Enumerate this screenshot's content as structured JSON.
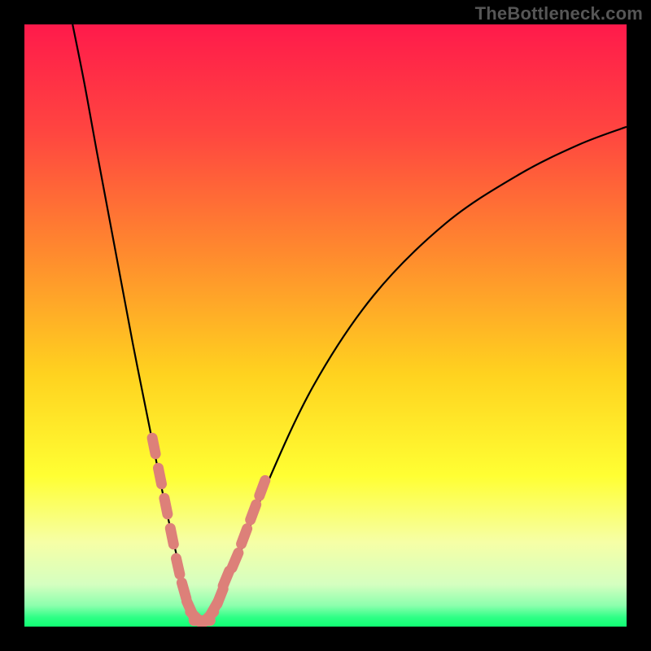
{
  "watermark": "TheBottleneck.com",
  "colors": {
    "frame": "#000000",
    "curve": "#000000",
    "dot_fill": "#dd8079",
    "gradient_stops": [
      {
        "pos": 0.0,
        "color": "#ff1a4b"
      },
      {
        "pos": 0.18,
        "color": "#ff4640"
      },
      {
        "pos": 0.38,
        "color": "#ff8a2e"
      },
      {
        "pos": 0.58,
        "color": "#ffd21f"
      },
      {
        "pos": 0.75,
        "color": "#ffff33"
      },
      {
        "pos": 0.86,
        "color": "#f6ffa6"
      },
      {
        "pos": 0.93,
        "color": "#d5ffc0"
      },
      {
        "pos": 0.965,
        "color": "#8cffad"
      },
      {
        "pos": 0.985,
        "color": "#2dff85"
      },
      {
        "pos": 1.0,
        "color": "#10ff73"
      }
    ]
  },
  "chart_data": {
    "type": "line",
    "title": "",
    "xlabel": "",
    "ylabel": "",
    "xlim": [
      0,
      100
    ],
    "ylim": [
      0,
      100
    ],
    "series": [
      {
        "name": "bottleneck-curve",
        "x": [
          8,
          10,
          12,
          15,
          18,
          21,
          23,
          25,
          26.5,
          28,
          30,
          32,
          35,
          40,
          48,
          58,
          70,
          82,
          92,
          100
        ],
        "y": [
          100,
          90,
          79,
          63,
          47,
          32,
          22,
          13,
          7,
          2,
          1,
          3,
          10,
          23,
          40,
          55,
          67,
          75,
          80,
          83
        ]
      }
    ],
    "dots": {
      "name": "highlighted-range",
      "x": [
        21.5,
        22.5,
        23.5,
        24.5,
        25.5,
        26.5,
        27.5,
        28.5,
        29.5,
        30.5,
        31.5,
        32.5,
        33.5,
        35,
        36.5,
        38,
        39.5
      ],
      "y": [
        30,
        25,
        20,
        15,
        10,
        6,
        3,
        1.5,
        1,
        1.5,
        3,
        5,
        8,
        11,
        15,
        19,
        23
      ]
    }
  }
}
